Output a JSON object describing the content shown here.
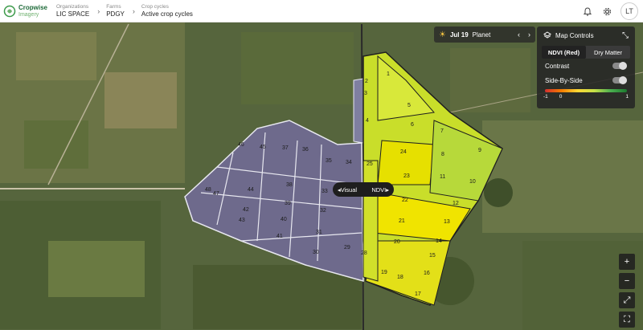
{
  "brand": {
    "name": "Cropwise",
    "sub": "Imagery"
  },
  "breadcrumbs": [
    {
      "label": "Organizations",
      "value": "LIC SPACE"
    },
    {
      "label": "Farms",
      "value": "PDGY"
    },
    {
      "label": "Crop cycles",
      "value": "Active crop cycles"
    }
  ],
  "header": {
    "avatar": "LT",
    "icons": [
      "bell-icon",
      "settings-icon"
    ]
  },
  "date_chip": {
    "date": "Jul 19",
    "source": "Planet",
    "prev": "‹",
    "next": "›"
  },
  "map_controls": {
    "title": "Map Controls",
    "tabs": [
      "NDVI (Red)",
      "Dry Matter"
    ],
    "active_tab": "NDVI (Red)",
    "contrast_label": "Contrast",
    "side_by_side_label": "Side-By-Side",
    "scale_labels": [
      "-1",
      "0",
      "1"
    ],
    "colors": {
      "low": "#d32f2f",
      "mid": "#fdd835",
      "high": "#1b7a2f"
    }
  },
  "splitter": {
    "left": "Visual",
    "right": "NDVI"
  },
  "zoom": {
    "in": "+",
    "out": "−",
    "expand": "⤢",
    "focus": "⛶"
  },
  "paddock_numbers_visual": [
    "46",
    "45",
    "37",
    "36",
    "35",
    "34",
    "38",
    "44",
    "48",
    "47",
    "43",
    "39",
    "40",
    "42",
    "41",
    "31",
    "30",
    "29",
    "33",
    "32"
  ],
  "paddock_numbers_ndvi": [
    "1",
    "2",
    "3",
    "4",
    "5",
    "6",
    "7",
    "8",
    "9",
    "10",
    "11",
    "12",
    "13",
    "14",
    "15",
    "16",
    "17",
    "18",
    "19",
    "20",
    "21",
    "22",
    "23",
    "24",
    "25",
    "26",
    "28"
  ]
}
